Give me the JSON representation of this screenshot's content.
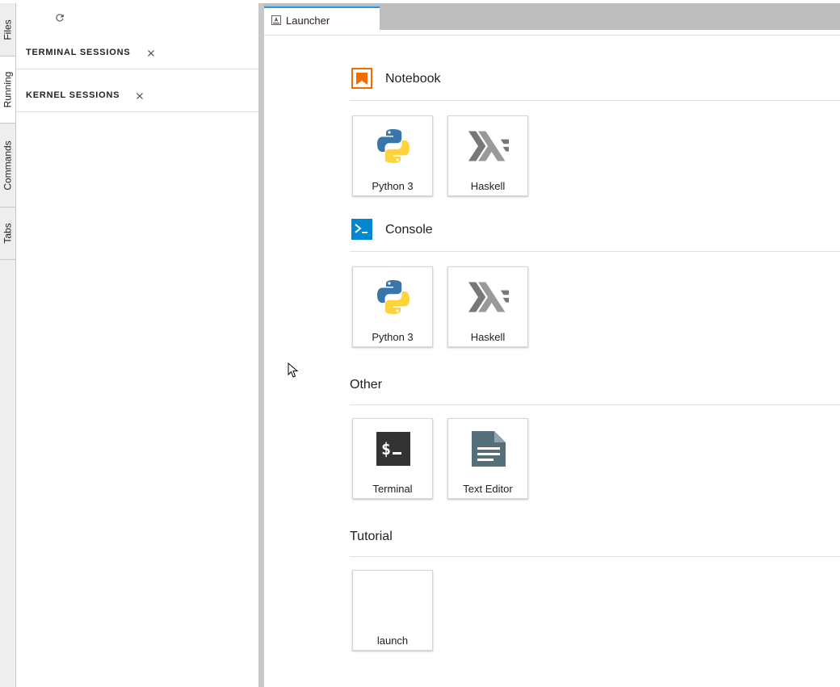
{
  "left_tabs": [
    {
      "id": "files",
      "label": "Files"
    },
    {
      "id": "running",
      "label": "Running"
    },
    {
      "id": "commands",
      "label": "Commands"
    },
    {
      "id": "tabs",
      "label": "Tabs"
    }
  ],
  "running_panel": {
    "refresh_icon": "refresh-icon",
    "terminal_sessions_title": "TERMINAL SESSIONS",
    "kernel_sessions_title": "KERNEL SESSIONS"
  },
  "main_tab": {
    "label": "Launcher",
    "icon": "launcher-icon"
  },
  "launcher": {
    "notebook": {
      "title": "Notebook",
      "color": "#ef6c00",
      "cards": [
        "Python 3",
        "Haskell"
      ]
    },
    "console": {
      "title": "Console",
      "color": "#0288d1",
      "cards": [
        "Python 3",
        "Haskell"
      ]
    },
    "other": {
      "title": "Other",
      "cards": [
        "Terminal",
        "Text Editor"
      ]
    },
    "tutorial": {
      "title": "Tutorial",
      "cards": [
        "launch"
      ]
    }
  }
}
